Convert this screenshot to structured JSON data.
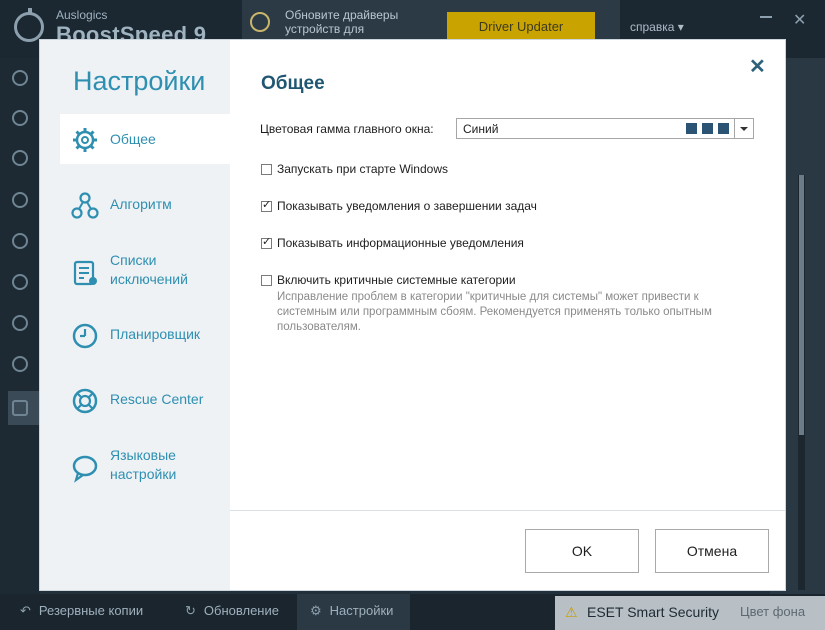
{
  "app": {
    "brand_small": "Auslogics",
    "brand_big": "BoostSpeed 9",
    "promo_text": "Обновите драйверы устройств для",
    "driver_button": "Driver Updater",
    "help_menu": "справка ▾",
    "window_close": "✕"
  },
  "bottom_bar": {
    "backups": "Резервные копии",
    "update": "Обновление",
    "settings": "Настройки",
    "eset_text": "ESET Smart Security",
    "eset_sub": "Цвет фона"
  },
  "dialog": {
    "sidebar_title": "Настройки",
    "nav": [
      {
        "label": "Общее",
        "icon": "gear-icon",
        "active": true
      },
      {
        "label": "Алгоритм",
        "icon": "algorithm-icon",
        "active": false
      },
      {
        "label": "Списки исключений",
        "icon": "exclusions-list-icon",
        "active": false
      },
      {
        "label": "Планировщик",
        "icon": "clock-icon",
        "active": false
      },
      {
        "label": "Rescue Center",
        "icon": "lifebuoy-icon",
        "active": false
      },
      {
        "label": "Языковые настройки",
        "icon": "speech-bubble-icon",
        "active": false
      }
    ],
    "section_title": "Общее",
    "color_scheme_label": "Цветовая гамма главного окна:",
    "color_scheme_value": "Синий",
    "color_scheme_swatch": "#2a5374",
    "checkboxes": [
      {
        "label": "Запускать при старте Windows",
        "checked": false
      },
      {
        "label": "Показывать уведомления о завершении задач",
        "checked": true
      },
      {
        "label": "Показывать информационные уведомления",
        "checked": true
      },
      {
        "label": "Включить критичные системные категории",
        "checked": false
      }
    ],
    "critical_hint": "Исправление проблем в категории \"критичные для системы\" может привести к системным или программным сбоям. Рекомендуется применять только опытным пользователям.",
    "ok_button": "OK",
    "cancel_button": "Отмена",
    "close_icon": "✕",
    "check_mark": "✓"
  },
  "colors": {
    "accent": "#2f8fb1",
    "title": "#1f5773",
    "warning": "#c89c00"
  }
}
